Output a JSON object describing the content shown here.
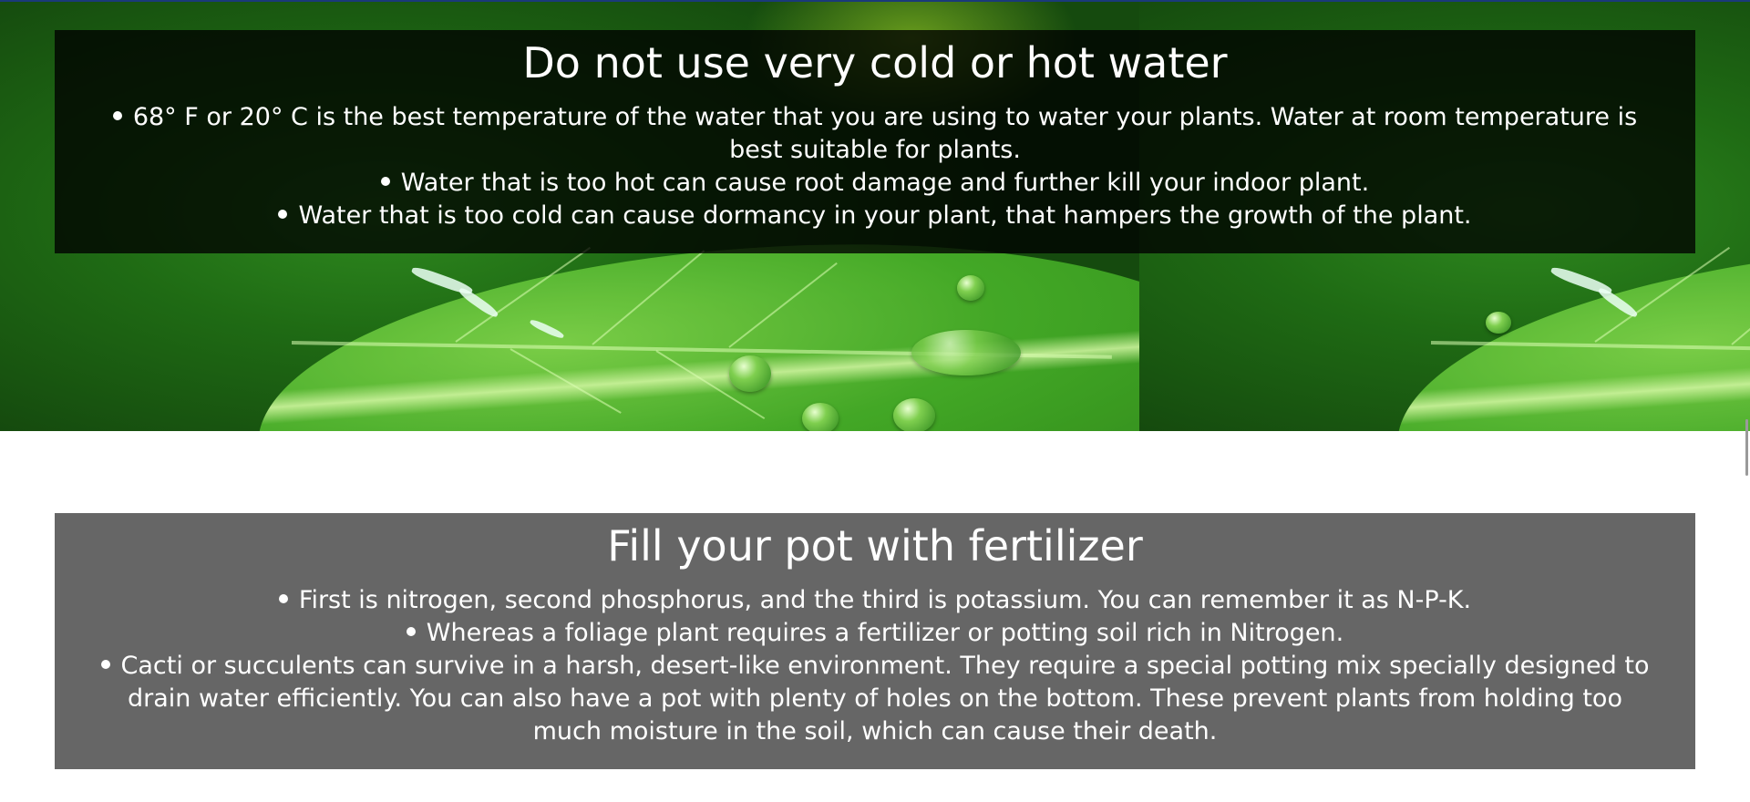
{
  "sections": [
    {
      "title": "Do not use very cold or hot water",
      "items": [
        "68° F or 20° C is the best temperature of the water that you are using to water your plants. Water at room temperature is best suitable for plants.",
        "Water that is too hot can cause root damage and further kill your indoor plant.",
        "Water that is too cold can cause dormancy in your plant, that hampers the growth of the plant."
      ]
    },
    {
      "title": "Fill your pot with fertilizer",
      "items": [
        "First is nitrogen, second phosphorus, and the third is potassium. You can remember it as N-P-K.",
        "Whereas a foliage plant requires a fertilizer or potting soil rich in Nitrogen.",
        "Cacti or succulents can survive in a harsh, desert-like environment. They require a special potting mix specially designed to drain water efficiently. You can also have a pot with plenty of holes on the bottom. These prevent plants from holding too much moisture in the soil, which can cause their death."
      ]
    }
  ],
  "colors": {
    "dark_box": "#000000c7",
    "grey_box": "#666666",
    "text": "#ffffff",
    "leaf_green": "#46ad28"
  },
  "icons": {
    "hero_background": "water-droplets-on-leaf-image"
  }
}
